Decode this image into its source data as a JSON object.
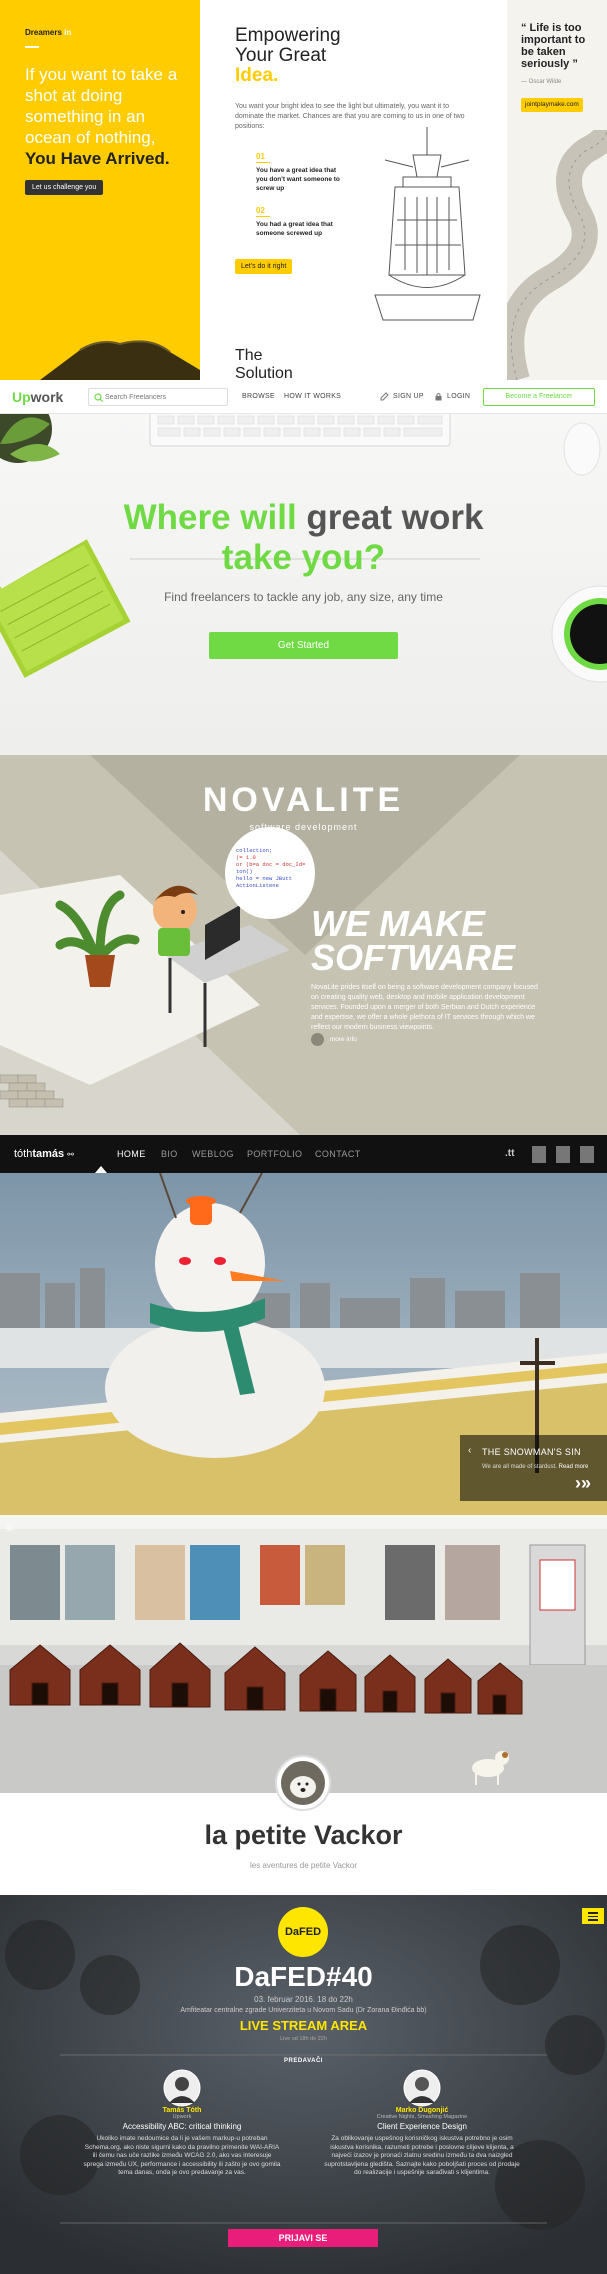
{
  "dreamers": {
    "brand": "Dreamers",
    "brand_suffix": "in",
    "headline": "If you want to take a shot at doing something in an ocean of nothing,",
    "headline_bold": "You Have Arrived.",
    "cta": "Let us challenge you",
    "title_line1": "Empowering",
    "title_line2": "Your Great",
    "title_highlight": "Idea.",
    "intro": "You want your bright idea to see the light but ultimately, you want it to dominate the market. Chances are that you are coming to us in one of two positions:",
    "option1_number": "01",
    "option1_text": "You have a great idea that you don't want someone to screw up",
    "option2_number": "02",
    "option2_text": "You had a great idea that someone screwed up",
    "cta2": "Let's do it right",
    "section_title_line1": "The",
    "section_title_line2": "Solution",
    "quote": "“ Life is too important to be taken seriously ”",
    "quote_author": "— Oscar Wilde",
    "cta3": "jointplaymake.com"
  },
  "upwork": {
    "logo_up": "Up",
    "logo_work": "work",
    "search_placeholder": "Search Freelancers",
    "nav_browse": "BROWSE",
    "nav_how": "HOW IT WORKS",
    "nav_signup": "SIGN UP",
    "nav_login": "LOGIN",
    "cta_freelancer": "Become a Freelancer",
    "headline_green1": "Where will",
    "headline_grey": "great work",
    "headline_green2": "take you?",
    "subtitle": "Find freelancers to tackle any job, any size, any time",
    "cta": "Get Started"
  },
  "novalite": {
    "logo": "NOVALITE",
    "tagline": "software development",
    "headline_line1": "WE MAKE",
    "headline_line2": "SOFTWARE",
    "body": "NovaLite prides itself on being a software development company focused on creating quality web, desktop and mobile application development services. Founded upon a merger of both Serbian and Dutch experience and expertise, we offer a whole plethora of IT services through which we reflect our modern business viewpoints.",
    "more": "more info",
    "code_lines": [
      "collection;",
      "(= 1.0",
      "or (b=a doc = doc_Id=",
      "ton()",
      "hello = new JButt",
      "ActionListene"
    ]
  },
  "tothtamas": {
    "logo_light": "tóth",
    "logo_bold": "tamás",
    "nav": [
      "HOME",
      "BIO",
      "WEBLOG",
      "PORTFOLIO",
      "CONTACT"
    ],
    "tt_mark": ".tt",
    "caption_title": "THE SNOWMAN'S SIN",
    "caption_text": "We are all made of stardust.",
    "caption_link": "Read more"
  },
  "vackor": {
    "title": "la petite Vackor",
    "subtitle": "les aventures de petite Vackor"
  },
  "dafed": {
    "logo": "DaFED",
    "title": "DaFED#40",
    "date": "03. februar 2016. 18 do 22h",
    "venue": "Amfiteatar centralne zgrade Univerziteta u Novom Sadu (Dr Zorana Đinđića bb)",
    "live": "LIVE STREAM AREA",
    "live_sub": "Live od 18h do 22h",
    "speakers_label": "PREDAVAČI",
    "speakers": [
      {
        "name": "Tamás Tóth",
        "role": "Upwork",
        "topic": "Accessibility ABC: critical thinking",
        "desc": "Ukoliko imate nedoumice da li je vašem markup-u potreban Schema.org, ako niste sigurni kako da pravilno primenite WAI-ARIA ili čemu nas uče razlike između WCAG 2.0, ako vas interesuje sprega između UX, performance i accessibility ili zašto je ovo gomila tema danas, onda je ovo predavanje za vas."
      },
      {
        "name": "Marko Dugonjić",
        "role": "Creative Nights, Smashing Magazine",
        "topic": "Client Experience Design",
        "desc": "Za oblikovanje uspešnog korisničkog iskustva potrebno je osim iskustva korisnika, razumeti potrebe i poslovne ciljeve klijenta, a najveći izazov je pronaći zlatnu sredinu između ta dva naizgled suprotstavljena gledišta. Saznajte kako poboljšati proces od prodaje do realizacije i uspešnije sarađivati s klijentima."
      }
    ],
    "cta": "PRIJAVI SE"
  }
}
